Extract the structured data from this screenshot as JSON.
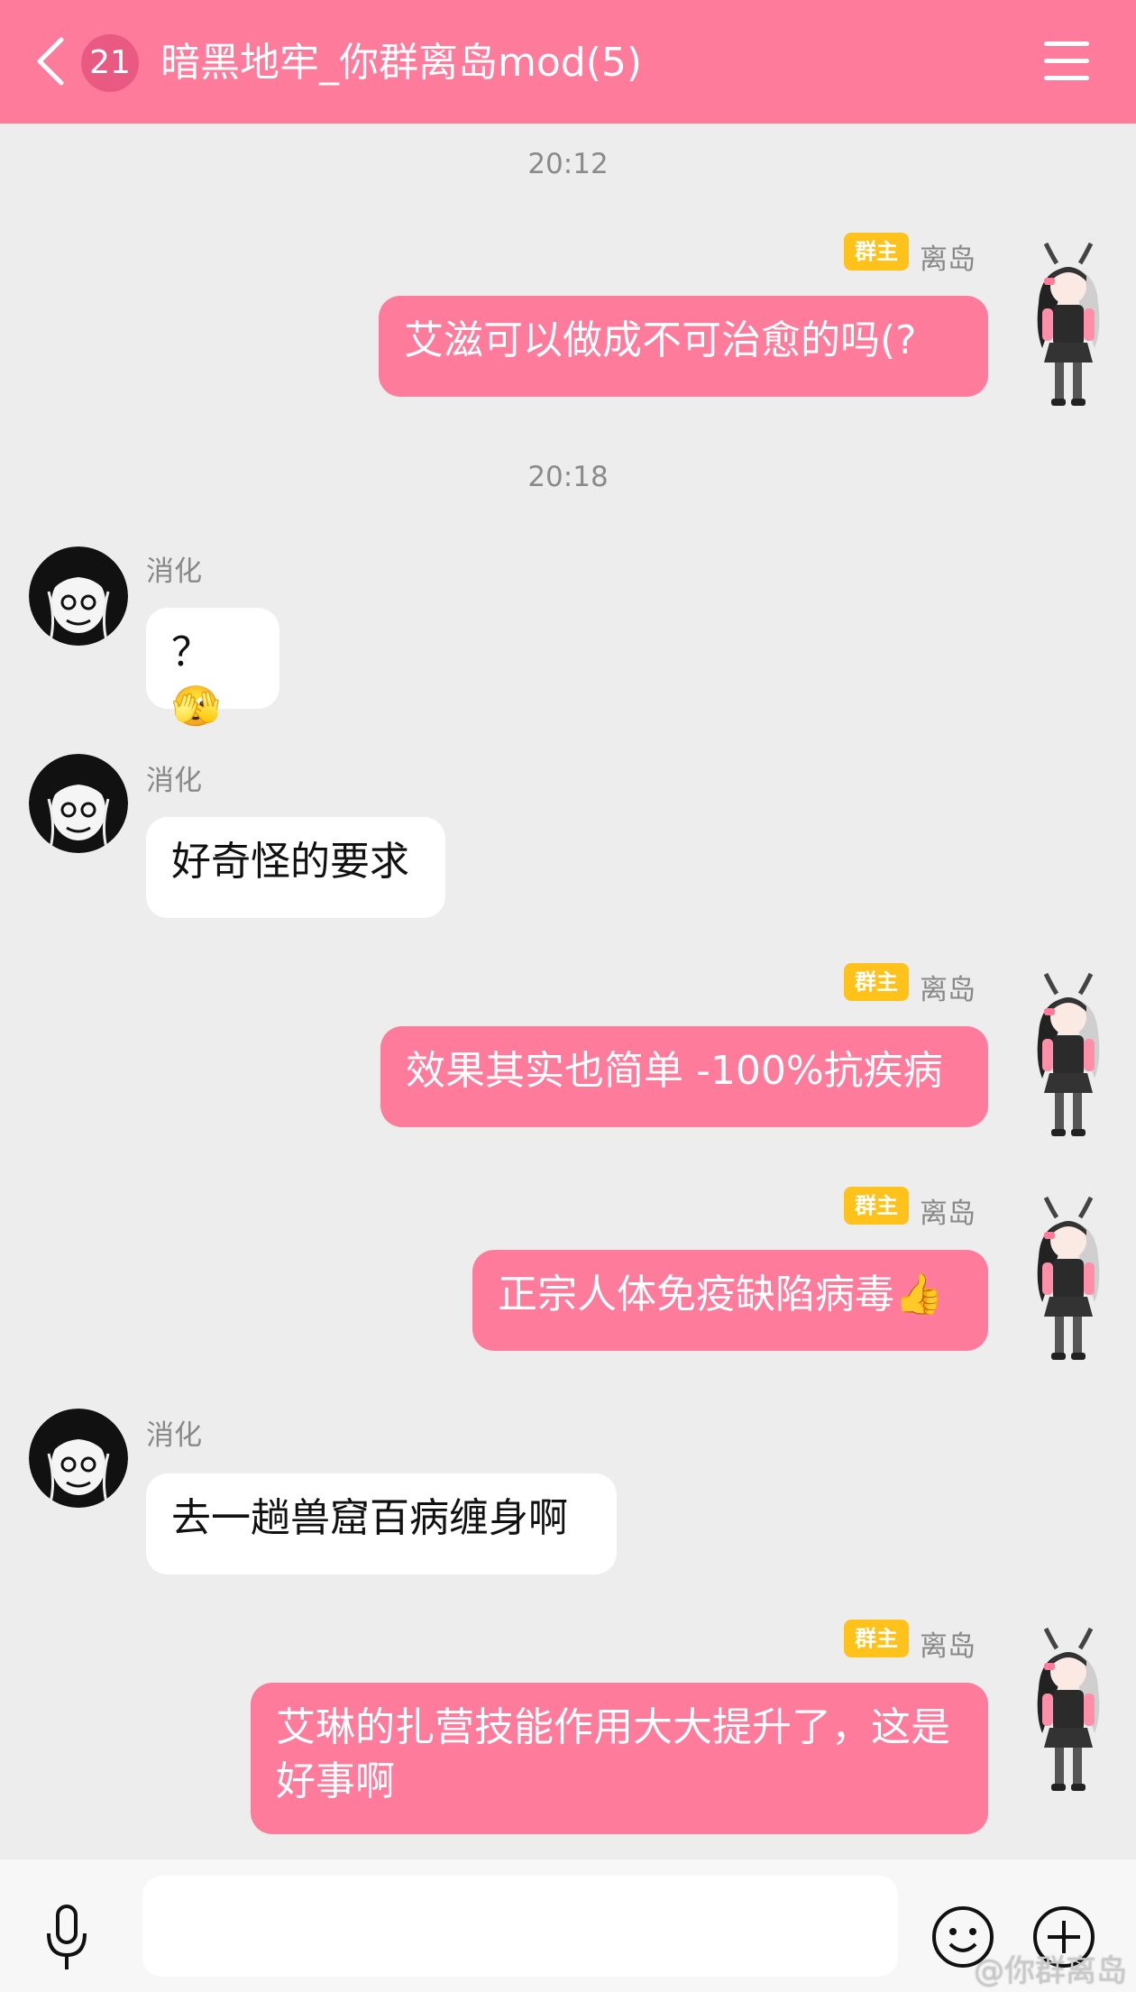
{
  "header": {
    "unread_count": "21",
    "title": "暗黑地牢_你群离岛mod(5)"
  },
  "timestamps": [
    "20:12",
    "20:18"
  ],
  "owner_badge": "群主",
  "messages": [
    {
      "sender": "离岛",
      "side": "mine",
      "owner": true,
      "text": "艾滋可以做成不可治愈的吗(?"
    },
    {
      "sender": "消化",
      "side": "theirs",
      "owner": false,
      "text": "？",
      "emoji": "🫣"
    },
    {
      "sender": "消化",
      "side": "theirs",
      "owner": false,
      "text": "好奇怪的要求"
    },
    {
      "sender": "离岛",
      "side": "mine",
      "owner": true,
      "text": "效果其实也简单 -100%抗疾病"
    },
    {
      "sender": "离岛",
      "side": "mine",
      "owner": true,
      "text": "正宗人体免疫缺陷病毒👍"
    },
    {
      "sender": "消化",
      "side": "theirs",
      "owner": false,
      "text": "去一趟兽窟百病缠身啊"
    },
    {
      "sender": "离岛",
      "side": "mine",
      "owner": true,
      "text": "艾琳的扎营技能作用大大提升了，这是好事啊"
    }
  ],
  "input": {
    "placeholder": ""
  },
  "watermark": "@你群离岛",
  "colors": {
    "accent": "#ff7b9c",
    "owner_badge": "#ffc21a",
    "background": "#ededed"
  }
}
